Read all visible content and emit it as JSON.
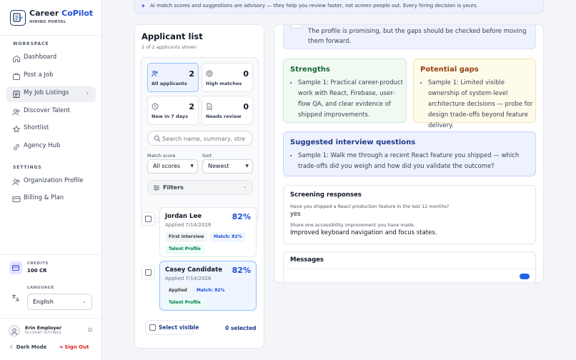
{
  "brand": {
    "title_main": "Career",
    "title_accent": "CoPilot",
    "subtitle": "HIRING PORTAL"
  },
  "sidebar": {
    "workspace_label": "WORKSPACE",
    "workspace_items": [
      {
        "label": "Dashboard",
        "icon": "dashboard-icon"
      },
      {
        "label": "Post a Job",
        "icon": "briefcase-icon"
      },
      {
        "label": "My Job Listings",
        "icon": "document-icon",
        "active": true
      },
      {
        "label": "Discover Talent",
        "icon": "users-icon"
      },
      {
        "label": "Shortlist",
        "icon": "star-icon"
      },
      {
        "label": "Agency Hub",
        "icon": "link-icon"
      }
    ],
    "settings_label": "SETTINGS",
    "settings_items": [
      {
        "label": "Organization Profile",
        "icon": "users-icon"
      },
      {
        "label": "Billing & Plan",
        "icon": "card-icon"
      }
    ],
    "credits_label": "CREDITS",
    "credits_value": "100 CR",
    "language_label": "LANGUAGE",
    "language_value": "English",
    "user_name": "Erin Employer",
    "user_sub": "ACCOUNT SETTINGS",
    "dark_mode": "Dark Mode",
    "sign_out": "Sign Out"
  },
  "banner": {
    "text": "AI match scores and suggestions are advisory — they help you review faster, not screen people out. Every hiring decision is yours."
  },
  "applicants": {
    "title": "Applicant list",
    "subtitle": "2 of 2 applicants shown",
    "stats": [
      {
        "label": "All applicants",
        "value": "2",
        "active": true
      },
      {
        "label": "High matches",
        "value": "0"
      },
      {
        "label": "New in 7 days",
        "value": "2"
      },
      {
        "label": "Needs review",
        "value": "0"
      }
    ],
    "search_placeholder": "Search name, summary, stre",
    "match_score_label": "Match score",
    "match_score_value": "All scores",
    "sort_label": "Sort",
    "sort_value": "Newest",
    "filters_label": "Filters",
    "candidates": [
      {
        "name": "Jordan Lee",
        "applied": "Applied 7/14/2026",
        "match_pct": "82%",
        "status": "First interview",
        "match_tag": "Match: 82%",
        "profile_tag": "Talent Profile"
      },
      {
        "name": "Casey Candidate",
        "applied": "Applied 7/14/2026",
        "match_pct": "82%",
        "status": "Applied",
        "match_tag": "Match: 82%",
        "profile_tag": "Talent Profile"
      }
    ],
    "select_visible": "Select visible",
    "selected_count": "0 selected"
  },
  "detail": {
    "summary": "The profile is promising, but the gaps should be checked before moving them forward.",
    "strengths_title": "Strengths",
    "strengths_item": "Sample 1: Practical career-product work with React, Firebase, user-flow QA, and clear evidence of shipped improvements.",
    "gaps_title": "Potential gaps",
    "gaps_item": "Sample 1: Limited visible ownership of system-level architecture decisions — probe for design trade-offs beyond feature delivery.",
    "questions_title": "Suggested interview questions",
    "questions_item": "Sample 1: Walk me through a recent React feature you shipped — which trade-offs did you weigh and how did you validate the outcome?",
    "screening_title": "Screening responses",
    "screening": [
      {
        "q": "Have you shipped a React production feature in the last 12 months?",
        "a": "yes"
      },
      {
        "q": "Share one accessibility improvement you have made.",
        "a": "Improved keyboard navigation and focus states."
      }
    ],
    "messages_title": "Messages"
  }
}
